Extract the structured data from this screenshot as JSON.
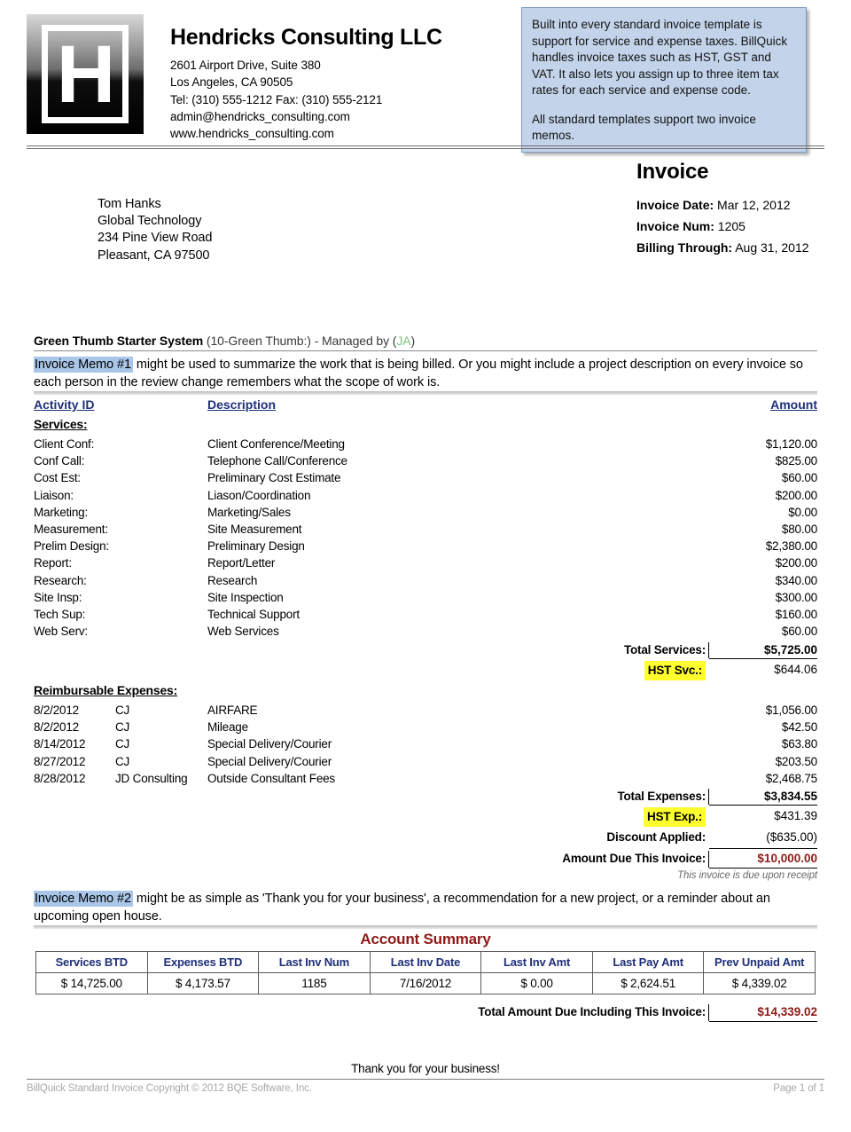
{
  "company": {
    "name": "Hendricks Consulting LLC",
    "address1": "2601 Airport Drive, Suite 380",
    "address2": "Los Angeles, CA 90505",
    "phone": "Tel: (310) 555-1212 Fax: (310) 555-2121",
    "email": "admin@hendricks_consulting.com",
    "website": "www.hendricks_consulting.com",
    "logo_letter": "H"
  },
  "callout": {
    "paragraph1": "Built into every standard invoice template is support for service and expense taxes. BillQuick handles invoice taxes such as HST, GST and VAT. It also lets you assign up to three item tax rates for each service and expense code.",
    "paragraph2": "All standard templates support two invoice memos.",
    "bg_color": "#c3d4ea"
  },
  "invoice": {
    "title": "Invoice",
    "date_label": "Invoice Date:",
    "date_value": "Mar 12, 2012",
    "num_label": "Invoice Num:",
    "num_value": "1205",
    "through_label": "Billing Through:",
    "through_value": "Aug 31, 2012"
  },
  "bill_to": {
    "name": "Tom Hanks",
    "company": "Global Technology",
    "street": "234 Pine View Road",
    "citystate": "Pleasant, CA 97500"
  },
  "project": {
    "name": "Green Thumb Starter System",
    "id": "(10-Green Thumb:)",
    "managed_prefix": "- Managed by (",
    "manager": "JA",
    "managed_suffix": ")"
  },
  "memo1": {
    "highlight": "Invoice Memo #1",
    "text": " might be used to summarize the work that is being billed. Or you might include a project description on every invoice so each person in the review change remembers what the scope of work is."
  },
  "memo2": {
    "highlight": "Invoice Memo #2",
    "text": " might be as simple as 'Thank you for your business', a recommendation for a new project, or a reminder about an upcoming open house."
  },
  "table": {
    "col_activity": "Activity ID",
    "col_description": "Description",
    "col_amount": "Amount",
    "services_label": "Services:",
    "expenses_label": "Reimbursable Expenses:"
  },
  "services": [
    {
      "id": "Client Conf:",
      "description": "Client Conference/Meeting",
      "amount": "$1,120.00"
    },
    {
      "id": "Conf Call:",
      "description": "Telephone Call/Conference",
      "amount": "$825.00"
    },
    {
      "id": "Cost Est:",
      "description": "Preliminary Cost Estimate",
      "amount": "$60.00"
    },
    {
      "id": "Liaison:",
      "description": "Liason/Coordination",
      "amount": "$200.00"
    },
    {
      "id": "Marketing:",
      "description": "Marketing/Sales",
      "amount": "$0.00"
    },
    {
      "id": "Measurement:",
      "description": "Site Measurement",
      "amount": "$80.00"
    },
    {
      "id": "Prelim Design:",
      "description": "Preliminary Design",
      "amount": "$2,380.00"
    },
    {
      "id": "Report:",
      "description": "Report/Letter",
      "amount": "$200.00"
    },
    {
      "id": "Research:",
      "description": "Research",
      "amount": "$340.00"
    },
    {
      "id": "Site Insp:",
      "description": "Site Inspection",
      "amount": "$300.00"
    },
    {
      "id": "Tech Sup:",
      "description": "Technical Support",
      "amount": "$160.00"
    },
    {
      "id": "Web Serv:",
      "description": "Web Services",
      "amount": "$60.00"
    }
  ],
  "expenses": [
    {
      "date": "8/2/2012",
      "employee": "CJ",
      "description": "AIRFARE",
      "amount": "$1,056.00"
    },
    {
      "date": "8/2/2012",
      "employee": "CJ",
      "description": "Mileage",
      "amount": "$42.50"
    },
    {
      "date": "8/14/2012",
      "employee": "CJ",
      "description": "Special Delivery/Courier",
      "amount": "$63.80"
    },
    {
      "date": "8/27/2012",
      "employee": "CJ",
      "description": "Special Delivery/Courier",
      "amount": "$203.50"
    },
    {
      "date": "8/28/2012",
      "employee": "JD Consulting",
      "description": "Outside Consultant Fees",
      "amount": "$2,468.75"
    }
  ],
  "totals": {
    "total_services_label": "Total Services:",
    "total_services_value": "$5,725.00",
    "hst_svc_label": "HST Svc.:",
    "hst_svc_value": "$644.06",
    "total_expenses_label": "Total Expenses:",
    "total_expenses_value": "$3,834.55",
    "hst_exp_label": "HST Exp.:",
    "hst_exp_value": "$431.39",
    "discount_label": "Discount Applied:",
    "discount_value": "($635.00)",
    "amount_due_label": "Amount Due This Invoice:",
    "amount_due_value": "$10,000.00",
    "due_note": "This invoice is due upon receipt",
    "highlight_color": "#ffff2e",
    "amount_color": "#8d1b17"
  },
  "account_summary": {
    "title": "Account Summary",
    "headers": [
      "Services BTD",
      "Expenses BTD",
      "Last Inv Num",
      "Last Inv Date",
      "Last Inv Amt",
      "Last Pay Amt",
      "Prev Unpaid Amt"
    ],
    "values": [
      "$ 14,725.00",
      "$ 4,173.57",
      "1185",
      "7/16/2012",
      "$ 0.00",
      "$ 2,624.51",
      "$ 4,339.02"
    ]
  },
  "grand_total": {
    "label": "Total Amount Due Including This Invoice:",
    "value": "$14,339.02"
  },
  "footer": {
    "thanks": "Thank you for your business!",
    "copyright": "BillQuick Standard Invoice Copyright © 2012 BQE Software, Inc.",
    "page": "Page 1 of 1"
  }
}
